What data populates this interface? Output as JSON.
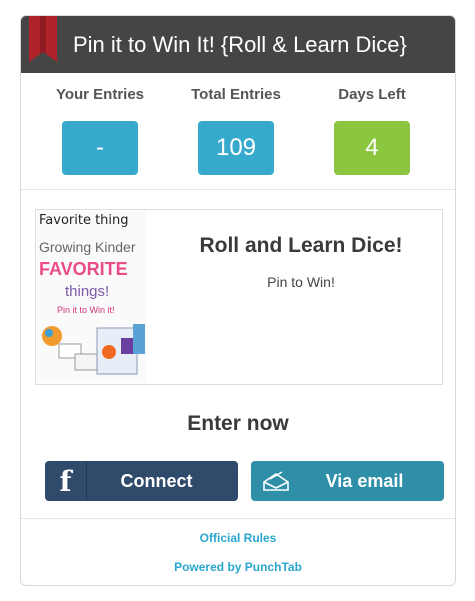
{
  "header": {
    "title": "Pin it to Win It! {Roll & Learn Dice}"
  },
  "stats": [
    {
      "label": "Your Entries",
      "value": "-",
      "color": "#36a9cc"
    },
    {
      "label": "Total Entries",
      "value": "109",
      "color": "#36a9cc"
    },
    {
      "label": "Days Left",
      "value": "4",
      "color": "#8cc63f"
    }
  ],
  "prize": {
    "title": "Roll and Learn Dice!",
    "subtitle": "Pin to Win!",
    "thumbnail_text": [
      "Favorite thing",
      "Growing Kinder",
      "FAVORITE",
      "things!",
      "Pin it to Win it!"
    ]
  },
  "enter": {
    "heading": "Enter now"
  },
  "buttons": {
    "facebook": "Connect",
    "email": "Via email"
  },
  "footer": {
    "rules": "Official Rules",
    "powered": "Powered by PunchTab"
  }
}
